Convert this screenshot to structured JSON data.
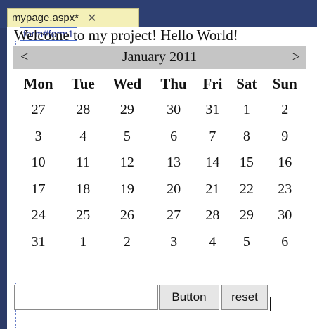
{
  "tab": {
    "title": "mypage.aspx*",
    "close": "✕"
  },
  "form_tag": "form#form1",
  "welcome": "Welcome to my project! Hello World!",
  "calendar": {
    "prev": "<",
    "next": ">",
    "month": "January 2011",
    "days": [
      "Mon",
      "Tue",
      "Wed",
      "Thu",
      "Fri",
      "Sat",
      "Sun"
    ],
    "weeks": [
      [
        "27",
        "28",
        "29",
        "30",
        "31",
        "1",
        "2"
      ],
      [
        "3",
        "4",
        "5",
        "6",
        "7",
        "8",
        "9"
      ],
      [
        "10",
        "11",
        "12",
        "13",
        "14",
        "15",
        "16"
      ],
      [
        "17",
        "18",
        "19",
        "20",
        "21",
        "22",
        "23"
      ],
      [
        "24",
        "25",
        "26",
        "27",
        "28",
        "29",
        "30"
      ],
      [
        "31",
        "1",
        "2",
        "3",
        "4",
        "5",
        "6"
      ]
    ]
  },
  "textbox": {
    "value": ""
  },
  "buttons": {
    "button": "Button",
    "reset": "reset"
  }
}
